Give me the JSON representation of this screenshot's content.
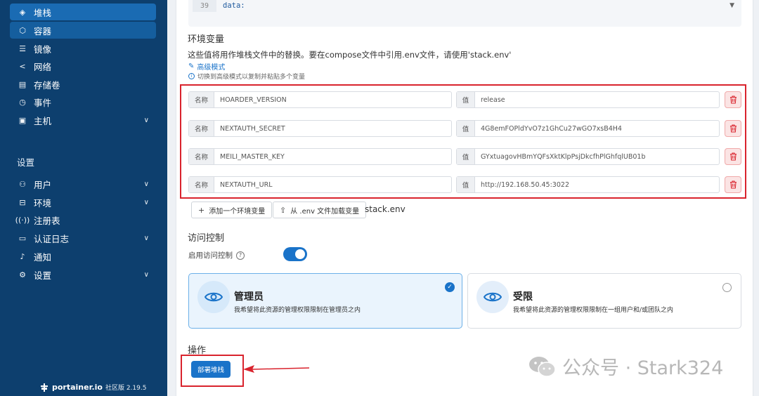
{
  "sidebar": {
    "items": [
      {
        "label": "堆栈",
        "icon": "layers-icon"
      },
      {
        "label": "容器",
        "icon": "box-icon"
      },
      {
        "label": "镜像",
        "icon": "list-icon"
      },
      {
        "label": "网络",
        "icon": "share-icon"
      },
      {
        "label": "存储卷",
        "icon": "database-icon"
      },
      {
        "label": "事件",
        "icon": "clock-icon"
      },
      {
        "label": "主机",
        "icon": "server-icon"
      }
    ],
    "settings_title": "设置",
    "settings_items": [
      {
        "label": "用户",
        "icon": "users-icon"
      },
      {
        "label": "环境",
        "icon": "hdd-icon"
      },
      {
        "label": "注册表",
        "icon": "radio-icon"
      },
      {
        "label": "认证日志",
        "icon": "file-icon"
      },
      {
        "label": "通知",
        "icon": "bell-icon"
      },
      {
        "label": "设置",
        "icon": "gear-icon"
      }
    ],
    "brand": {
      "name": "portainer.io",
      "edition": "社区版 2.19.5"
    }
  },
  "editor": {
    "line_number": "39",
    "code": "data:"
  },
  "env": {
    "title": "环境变量",
    "description": "这些值将用作堆栈文件中的替换。要在compose文件中引用.env文件，请使用'stack.env'",
    "advanced_mode": "高级模式",
    "hint": "切换到高级模式以复制并粘贴多个变量",
    "name_label": "名称",
    "value_label": "值",
    "rows": [
      {
        "name": "HOARDER_VERSION",
        "value": "release"
      },
      {
        "name": "NEXTAUTH_SECRET",
        "value": "4G8emFOPldYvO7z1GhCu27wGO7xsB4H4"
      },
      {
        "name": "MEILI_MASTER_KEY",
        "value": "GYxtuagovHBmYQFsXktKlpPsjDkcfhPlGhfqlUB01b"
      },
      {
        "name": "NEXTAUTH_URL",
        "value": "http://192.168.50.45:3022"
      }
    ],
    "add_button": "添加一个环境变量",
    "load_button": "从 .env 文件加载变量",
    "stack_env": "stack.env"
  },
  "access": {
    "title": "访问控制",
    "toggle_label": "启用访问控制",
    "toggle_on": true,
    "cards": [
      {
        "title": "管理员",
        "desc": "我希望将此资源的管理权限限制在管理员之内",
        "selected": true
      },
      {
        "title": "受限",
        "desc": "我希望将此资源的管理权限限制在一组用户和/或团队之内",
        "selected": false
      }
    ]
  },
  "actions": {
    "title": "操作",
    "deploy_button": "部署堆栈"
  },
  "watermark": {
    "text": "公众号 · Stark324"
  },
  "colors": {
    "sidebar": "#0d3f6e",
    "active": "#1a6bb3",
    "primary": "#1a73c9",
    "danger": "#d9232d"
  }
}
